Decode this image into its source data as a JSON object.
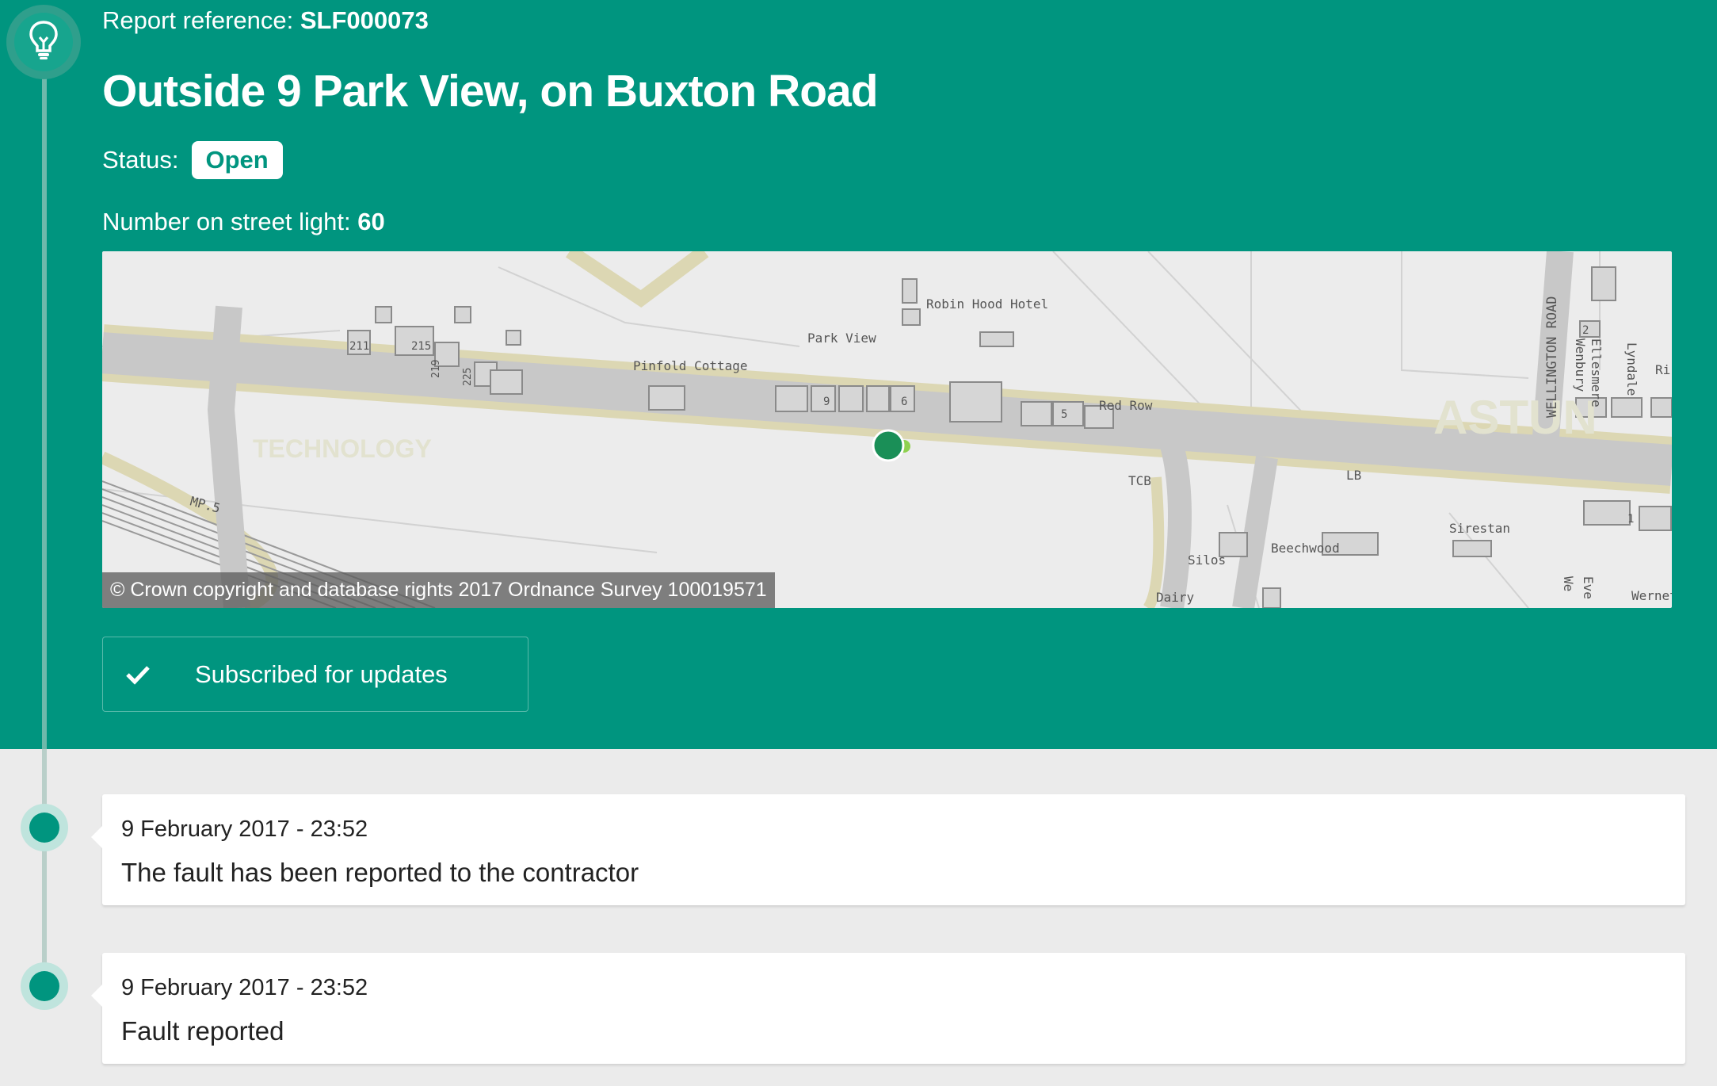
{
  "report": {
    "reference_label": "Report reference:",
    "reference_value": "SLF000073",
    "title": "Outside 9 Park View, on Buxton Road",
    "status_label": "Status:",
    "status_value": "Open",
    "light_number_label": "Number on street light:",
    "light_number_value": "60",
    "icon": "lightbulb-icon"
  },
  "map": {
    "copyright": "© Crown copyright and database rights 2017 Ordnance Survey 100019571",
    "labels": {
      "robin_hood": "Robin Hood Hotel",
      "park_view": "Park View",
      "pinfold": "Pinfold Cottage",
      "red_row": "Red Row",
      "wellington": "WELLINGTON ROAD",
      "tcb": "TCB",
      "lb": "LB",
      "silos": "Silos",
      "dairy": "Dairy",
      "beechwood": "Beechwood",
      "sirestan": "Sirestan",
      "mp": "MP.5",
      "wernet": "Wernet",
      "ellesmere": "Ellesmere",
      "wenbury": "Wenbury",
      "lyndale": "Lyndale",
      "n211": "211",
      "n215": "215",
      "n219": "219",
      "n225": "225",
      "n9": "9",
      "n5": "5",
      "n6": "6",
      "n2": "2",
      "n1": "1",
      "ri": "Ri",
      "we": "We",
      "eve": "Eve",
      "watermark": "ASTUN",
      "watermark2": "TECHNOLOGY"
    },
    "marker_color": "#1a8f57"
  },
  "subscribe": {
    "label": "Subscribed for updates",
    "icon": "check-icon"
  },
  "updates": [
    {
      "date": "9 February 2017 - 23:52",
      "message": "The fault has been reported to the contractor"
    },
    {
      "date": "9 February 2017 - 23:52",
      "message": "Fault reported"
    }
  ],
  "colors": {
    "brand": "#00957f",
    "background": "#ebebeb"
  }
}
